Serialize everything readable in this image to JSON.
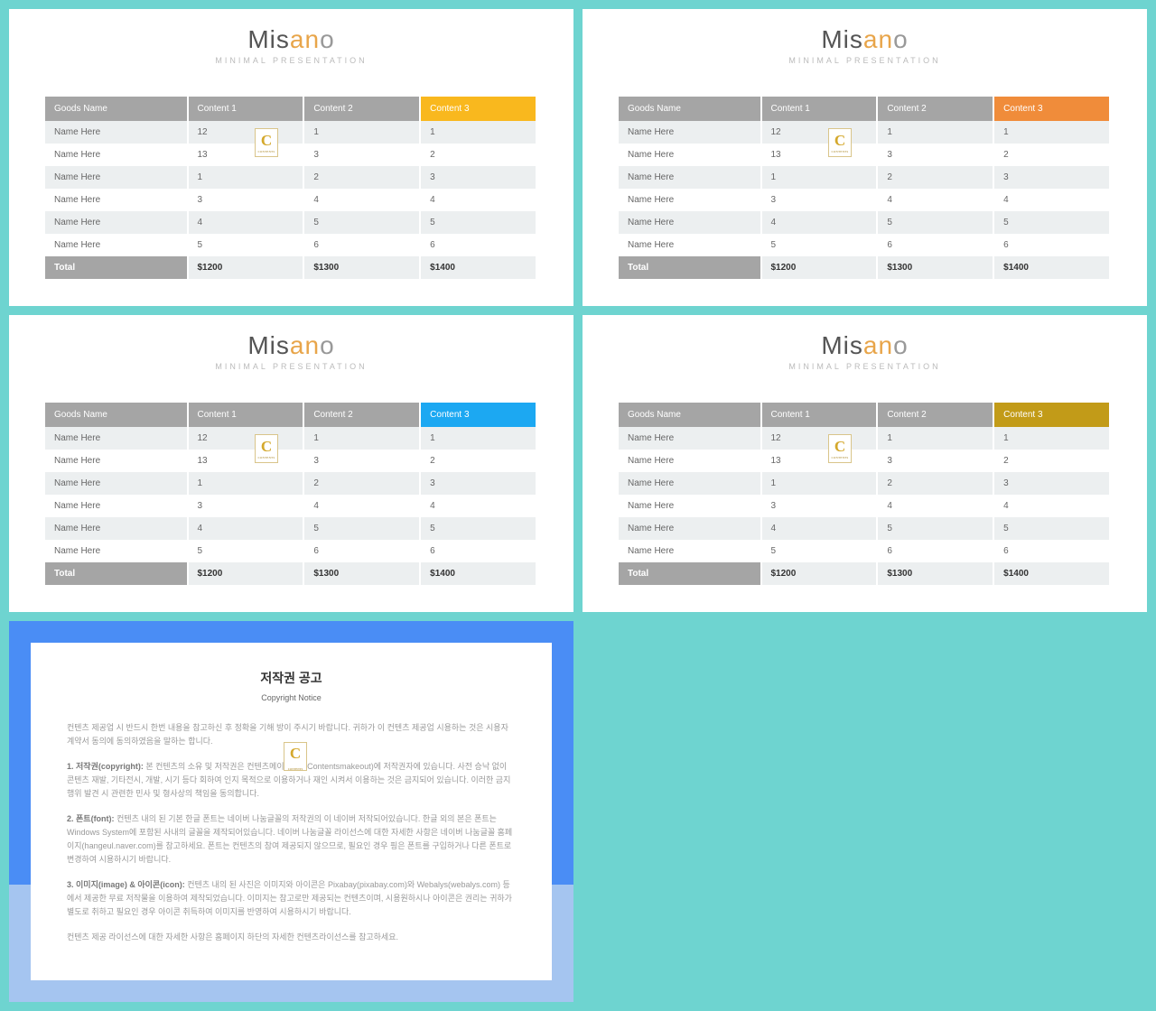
{
  "logo": {
    "part1": "Mis",
    "part2": "an",
    "part3": "o"
  },
  "subtitle": "Minimal Presentation",
  "headers": {
    "c0": "Goods Name",
    "c1": "Content 1",
    "c2": "Content 2",
    "c3": "Content 3"
  },
  "rows": [
    {
      "name": "Name Here",
      "c1": "12",
      "c2": "1",
      "c3": "1"
    },
    {
      "name": "Name Here",
      "c1": "13",
      "c2": "3",
      "c3": "2"
    },
    {
      "name": "Name Here",
      "c1": "1",
      "c2": "2",
      "c3": "3"
    },
    {
      "name": "Name Here",
      "c1": "3",
      "c2": "4",
      "c3": "4"
    },
    {
      "name": "Name Here",
      "c1": "4",
      "c2": "5",
      "c3": "5"
    },
    {
      "name": "Name Here",
      "c1": "5",
      "c2": "6",
      "c3": "6"
    }
  ],
  "total": {
    "label": "Total",
    "c1": "$1200",
    "c2": "$1300",
    "c3": "$1400"
  },
  "watermark": {
    "letter": "C",
    "sub": "CONTENTS"
  },
  "accents": [
    "accent-yellow",
    "accent-orange",
    "accent-blue",
    "accent-olive"
  ],
  "copyright": {
    "title": "저작권 공고",
    "subtitle": "Copyright Notice",
    "p1": "컨텐츠 제공업 시 반드시 한번 내용을 참고하신 후 정확을 기해 방이 주시기 바랍니다. 귀하가 이 컨텐츠 제공업 시용하는 것은 시용자 계약서 동의에 동의하였음을 말하는 합니다.",
    "p2_label": "1. 저작권(copyright):",
    "p2": "본 컨텐츠의 소유 및 저작권은 컨텐츠메이커(즉)(Contentsmakeout)에 저작권자에 있습니다. 사전 승낙 없이 콘텐츠 재발, 기타전시, 개발, 시기 등다 회하여 인지 목적으로 이용하거나 재인 시켜서 이용하는 것은 금지되어 있습니다. 이러한 금지 행위 발견 시 관련한 민사 및 형사상의 책임을 동의합니다.",
    "p3_label": "2. 폰트(font):",
    "p3": "컨텐츠 내의 된 기본 한글 폰트는 네이버 나눔글꼴의 저작권의 이 네이버 저작되어있습니다. 한글 외의 본은 폰트는 Windows System에 포함된 사내의 글꼴을 제작되어있습니다. 네이버 나눔글꼴 라이선스에 대한 자세한 사항은 네이버 나눔글꼴 홈페이지(hangeul.naver.com)를 참고하세요. 폰트는 컨텐츠의 참여 제공되지 않으므로, 필요인 경우 핑은 폰트를 구입하거나 다른 폰트로 변경하여 시용하시기 바랍니다.",
    "p4_label": "3. 이미지(image) & 아이콘(icon):",
    "p4": "컨텐츠 내의 된 사진은 이미지와 아이콘은 Pixabay(pixabay.com)와 Webalys(webalys.com) 등에서 제공한 무료 저작물을 이용하여 제작되었습니다. 이미지는 참고로만 제공되는 컨텐츠이며, 시용원하시나 아이콘은 권리는 귀하가 별도로 취하고 필요인 경우 아이콘 취득하여 이미지를 반영하여 시용하시기 바랍니다.",
    "p5": "컨텐츠 제공 라이선스에 대한 자세한 사항은 홈페이지 하단의 자세한 컨텐츠라이선스를 참고하세요."
  }
}
